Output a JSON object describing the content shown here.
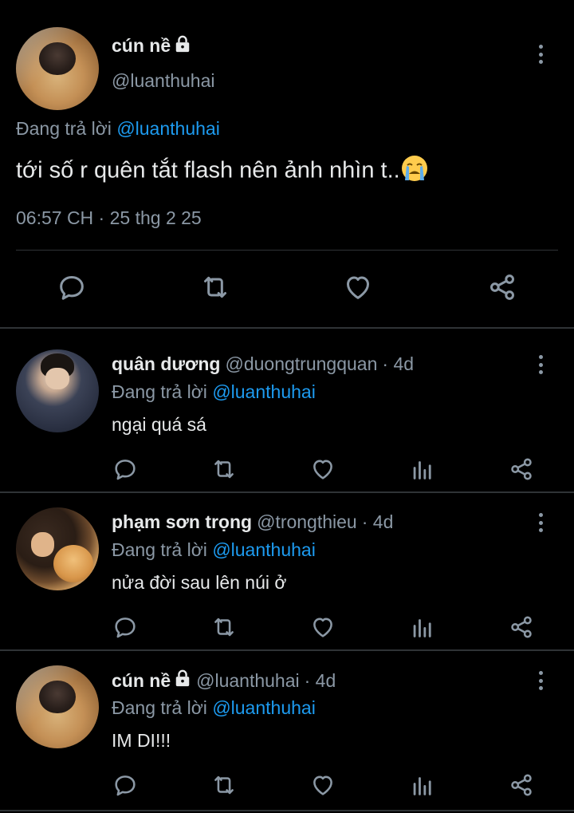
{
  "main_tweet": {
    "author_name": "cún nề",
    "handle": "@luanthuhai",
    "reply_prefix": "Đang trả lời ",
    "reply_to": "@luanthuhai",
    "text": "tới số r quên tắt flash nên ảnh nhìn t..",
    "time": "06:57 CH",
    "separator": " · ",
    "date": "25 thg 2 25",
    "actions": [
      "reply-icon",
      "retweet-icon",
      "like-icon",
      "share-icon"
    ]
  },
  "replies": [
    {
      "author_name": "quân dương",
      "handle": "@duongtrungquan",
      "age": "· 4d",
      "reply_prefix": "Đang trả lời ",
      "reply_to": "@luanthuhai",
      "text": "ngại quá sá"
    },
    {
      "author_name": "phạm sơn trọng",
      "handle": "@trongthieu",
      "age": "· 4d",
      "reply_prefix": "Đang trả lời ",
      "reply_to": "@luanthuhai",
      "text": "nửa đời sau lên núi ở"
    },
    {
      "author_name": "cún nề",
      "handle": "@luanthuhai",
      "age": "· 4d",
      "reply_prefix": "Đang trả lời ",
      "reply_to": "@luanthuhai",
      "text": "IM DI!!!"
    }
  ],
  "colors": {
    "background": "#000000",
    "text": "#e7e9ea",
    "muted": "#8b98a5",
    "accent": "#1d9bf0",
    "divider": "#2f3336"
  }
}
